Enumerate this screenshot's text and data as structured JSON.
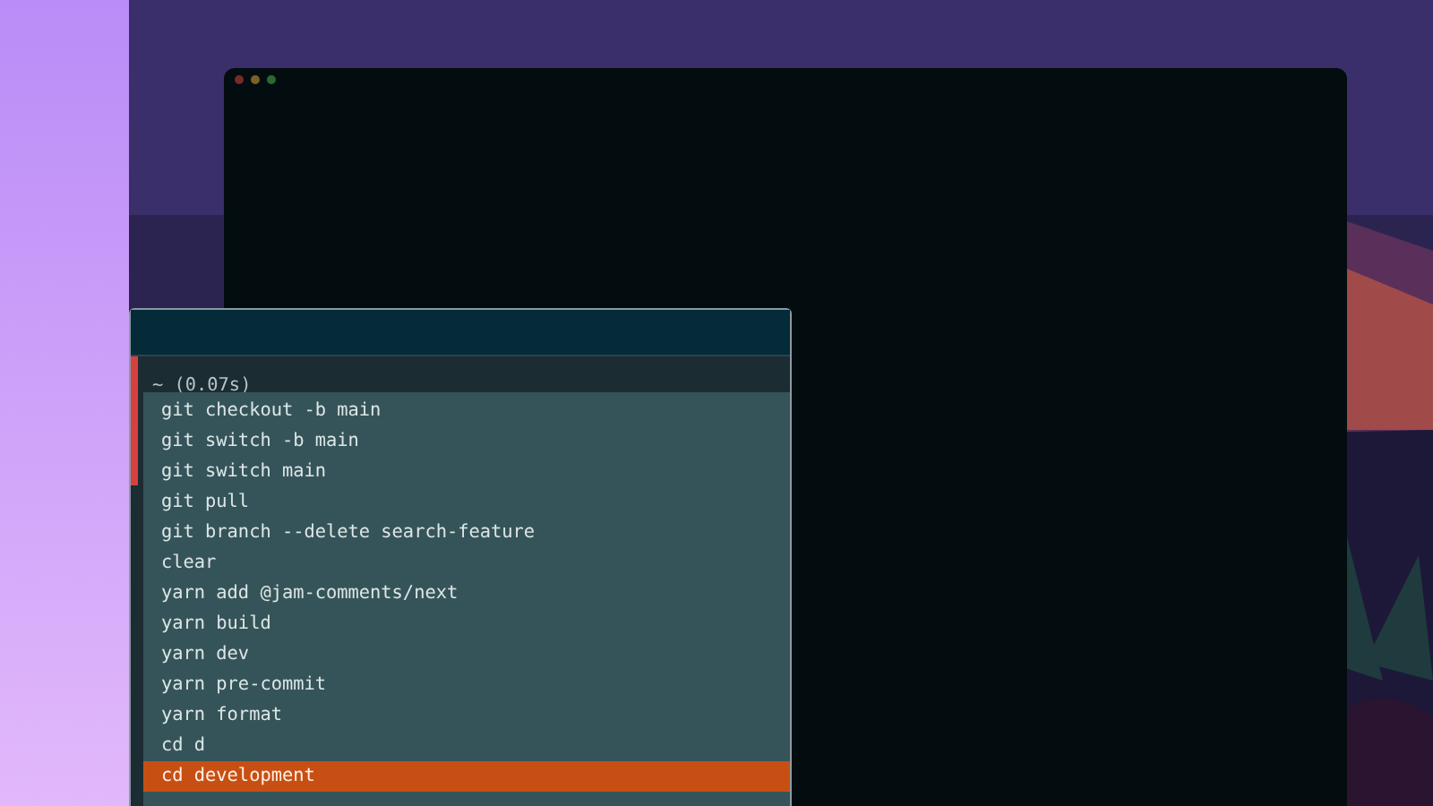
{
  "block": {
    "header": "~ (0.07s)"
  },
  "suggestions": [
    {
      "text": "git checkout -b main",
      "selected": false
    },
    {
      "text": "git switch -b main",
      "selected": false
    },
    {
      "text": "git switch main",
      "selected": false
    },
    {
      "text": "git pull",
      "selected": false
    },
    {
      "text": "git branch --delete search-feature",
      "selected": false
    },
    {
      "text": "clear",
      "selected": false
    },
    {
      "text": "yarn add @jam-comments/next",
      "selected": false
    },
    {
      "text": "yarn build",
      "selected": false
    },
    {
      "text": "yarn dev",
      "selected": false
    },
    {
      "text": "yarn pre-commit",
      "selected": false
    },
    {
      "text": "yarn format",
      "selected": false
    },
    {
      "text": "cd d",
      "selected": false
    },
    {
      "text": "cd development",
      "selected": true
    }
  ]
}
